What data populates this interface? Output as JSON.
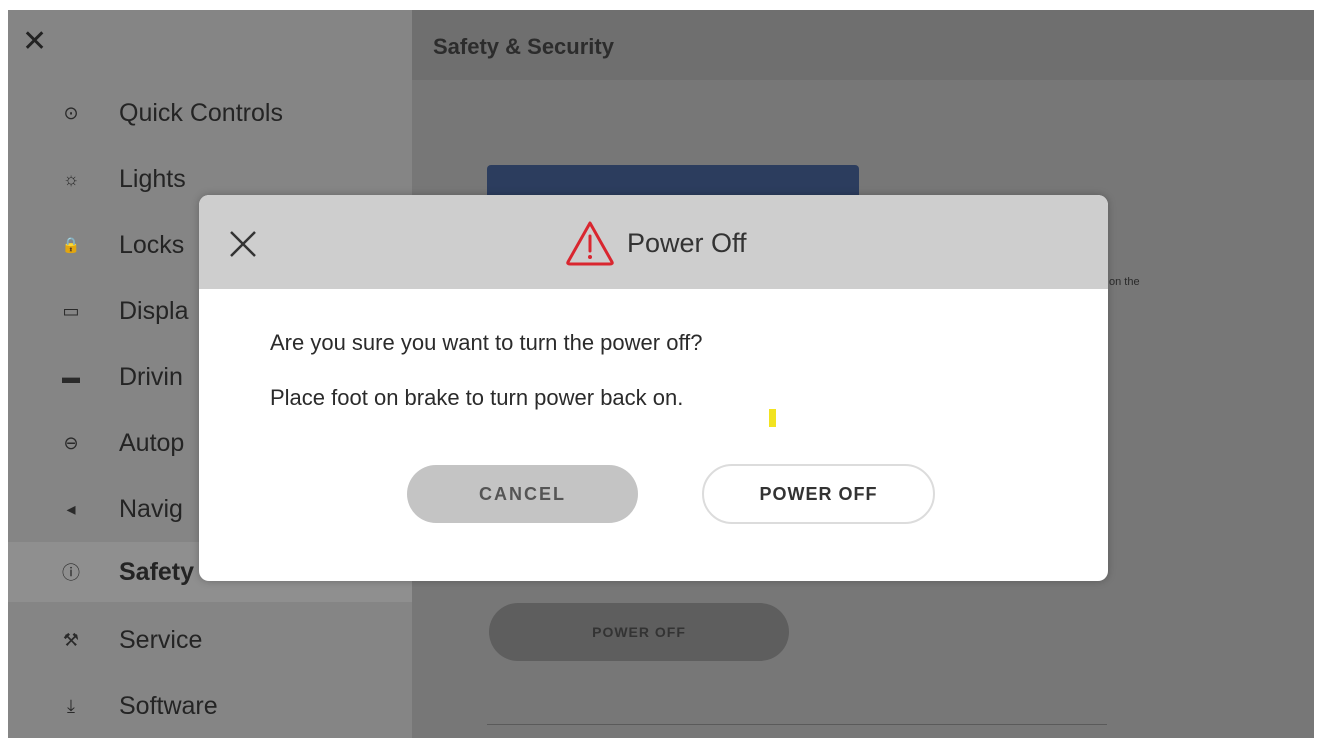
{
  "sidebar": {
    "items": [
      {
        "label": "Quick Controls",
        "icon": "toggle-icon",
        "glyph": "⊙"
      },
      {
        "label": "Lights",
        "icon": "light-bulb-icon",
        "glyph": "☼"
      },
      {
        "label": "Locks",
        "icon": "lock-icon",
        "glyph": "🔒"
      },
      {
        "label": "Displa",
        "icon": "display-icon",
        "glyph": "▭"
      },
      {
        "label": "Drivin",
        "icon": "car-icon",
        "glyph": "▬"
      },
      {
        "label": "Autop",
        "icon": "steering-wheel-icon",
        "glyph": "⊖"
      },
      {
        "label": "Navig",
        "icon": "navigation-arrow-icon",
        "glyph": "◂"
      },
      {
        "label": "Safety",
        "icon": "info-circle-icon",
        "glyph": "ⓘ"
      },
      {
        "label": "Service",
        "icon": "wrench-icon",
        "glyph": "⚒"
      },
      {
        "label": "Software",
        "icon": "download-icon",
        "glyph": "⤓"
      }
    ]
  },
  "main": {
    "title": "Safety & Security",
    "side_note": "on the",
    "power_off_label": "POWER OFF"
  },
  "modal": {
    "title": "Power Off",
    "line1": "Are you sure you want to turn the power off?",
    "line2": "Place foot on brake to turn power back on.",
    "cancel_label": "CANCEL",
    "confirm_label": "POWER OFF",
    "warning_color": "#d9262f"
  }
}
